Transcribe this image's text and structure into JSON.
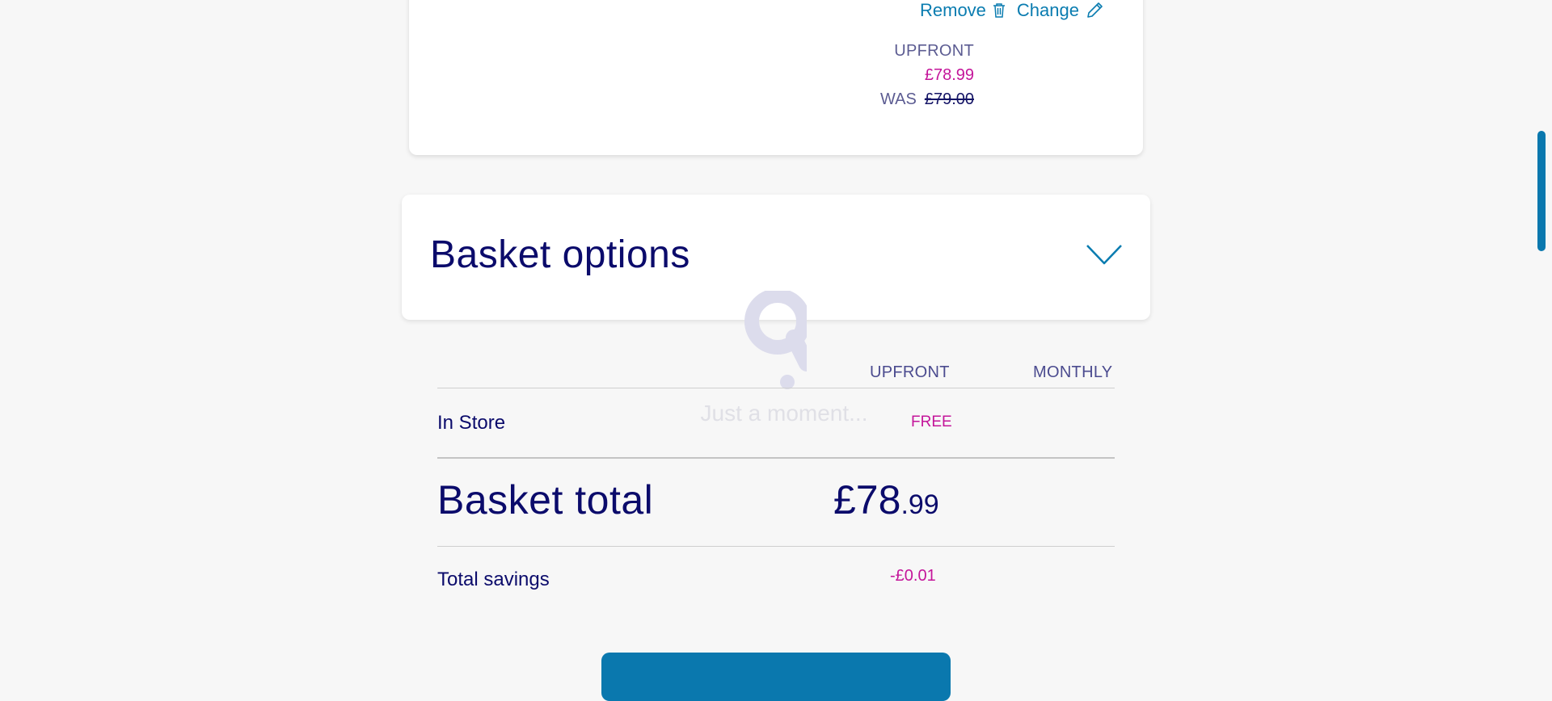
{
  "product_card": {
    "remove_label": "Remove",
    "change_label": "Change",
    "upfront_label": "UPFRONT",
    "price": "£78.99",
    "was_label": "WAS",
    "was_price": "£79.00"
  },
  "basket_options": {
    "title": "Basket options"
  },
  "loader": {
    "text": "Just a moment..."
  },
  "summary": {
    "columns": [
      "UPFRONT",
      "MONTHLY"
    ],
    "delivery": {
      "label": "In Store",
      "upfront": "FREE"
    },
    "total": {
      "label": "Basket total",
      "pounds": "£78",
      "pence": ".99"
    },
    "savings": {
      "label": "Total savings",
      "value": "-£0.01"
    }
  },
  "colors": {
    "brand_blue": "#0a78ae",
    "navy": "#0b0b6b",
    "magenta": "#c4159a"
  }
}
